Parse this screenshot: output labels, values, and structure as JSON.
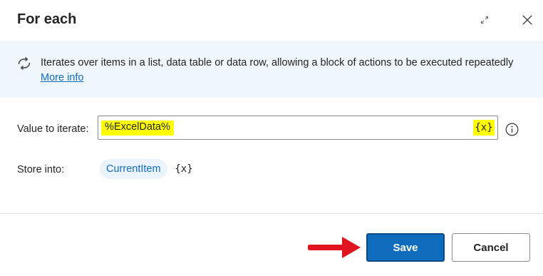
{
  "dialog": {
    "title": "For each",
    "expand_icon": "expand-diagonal-icon",
    "close_icon": "close-icon"
  },
  "info": {
    "icon": "loop-arrows-icon",
    "text": "Iterates over items in a list, data table or data row, allowing a block of actions to be executed repeatedly",
    "link": "More info"
  },
  "fields": {
    "value_label": "Value to iterate:",
    "value": "%ExcelData%",
    "variable_button": "{x}",
    "info_icon": "info-circle-icon",
    "store_label": "Store into:",
    "store_variable": "CurrentItem",
    "store_variable_button": "{x}"
  },
  "footer": {
    "save_label": "Save",
    "cancel_label": "Cancel"
  },
  "colors": {
    "accent": "#0f6cbd",
    "highlight": "#ffff00",
    "arrow": "#e0141e",
    "banner_bg": "#eff6fc"
  }
}
